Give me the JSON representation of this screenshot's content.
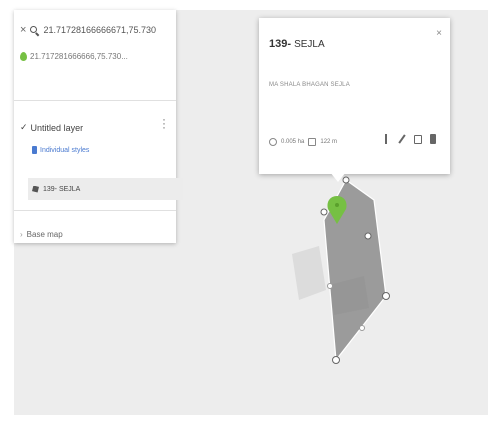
{
  "search": {
    "close_glyph": "×",
    "query": "21.71728166666671,75.730",
    "result_text": "21.717281666666,75.730..."
  },
  "layer": {
    "title": "Untitled layer",
    "style_link": "Individual styles",
    "feature_label": "139- SEJLA"
  },
  "basemap": {
    "label": "Base map"
  },
  "popup": {
    "title_main": "139-",
    "title_sub": "SEJLA",
    "close_glyph": "×",
    "description": "MA SHALA BHAGAN SEJLA",
    "area": "0.005 ha",
    "perimeter": "122 m"
  },
  "icons": {
    "close": "close-icon",
    "search": "search-icon",
    "pin": "pin-icon",
    "style": "paint-icon",
    "edit": "pencil-icon",
    "photo": "camera-icon",
    "delete": "trash-icon"
  },
  "colors": {
    "pin": "#76c043",
    "link": "#4a7ad0",
    "polygon": "#8c8c8c"
  }
}
